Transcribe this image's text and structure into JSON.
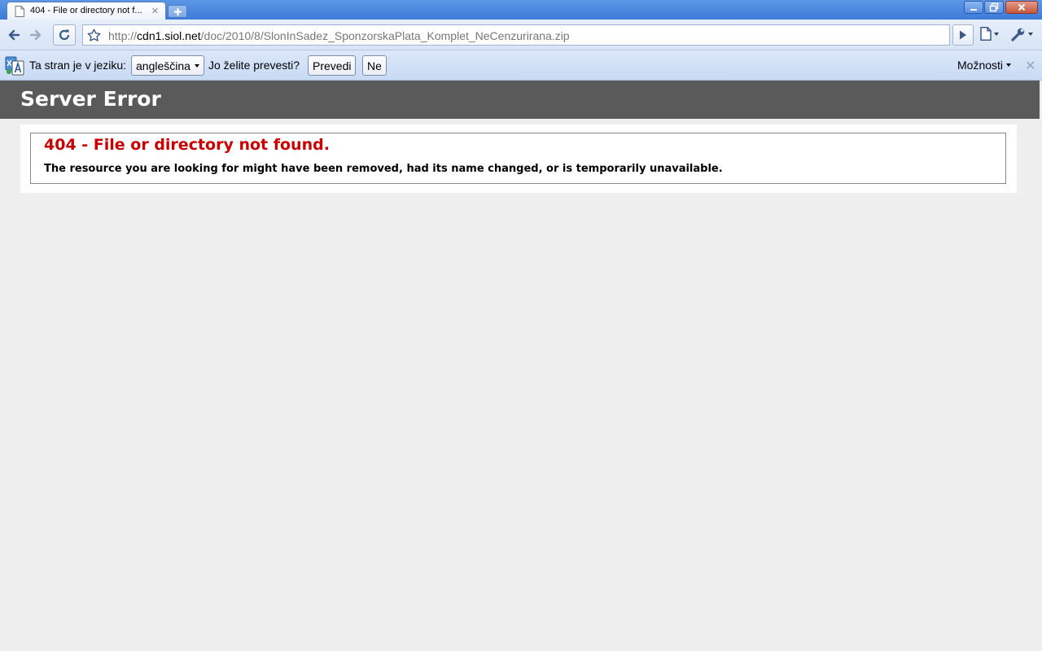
{
  "browser": {
    "tab_title": "404 - File or directory not f...",
    "url_scheme": "http://",
    "url_host": "cdn1.siol.net",
    "url_path": "/doc/2010/8/SlonInSadez_SponzorskaPlata_Komplet_NeCenzurirana.zip",
    "icons": {
      "back": "back-arrow-icon",
      "forward": "forward-arrow-icon",
      "reload": "reload-icon",
      "bookmark": "star-icon",
      "go": "play-icon",
      "page_menu": "page-icon",
      "tools_menu": "wrench-icon"
    }
  },
  "translate_bar": {
    "prompt": "Ta stran je v jeziku:",
    "language": "angleščina",
    "question": "Jo želite prevesti?",
    "translate_button": "Prevedi",
    "no_button": "Ne",
    "options": "Možnosti"
  },
  "page": {
    "header": "Server Error",
    "error_title": "404 - File or directory not found.",
    "error_message": "The resource you are looking for might have been removed, had its name changed, or is temporarily unavailable."
  },
  "colors": {
    "header_bg": "#5a5a5a",
    "error_title": "#cc0000",
    "page_bg": "#eeeeee"
  }
}
